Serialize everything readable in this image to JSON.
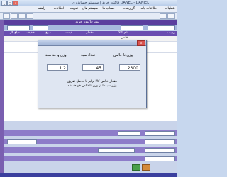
{
  "window": {
    "title": "فاکتور خرید  |  سیستم حسابداری DANEL  -  DANIEL",
    "buttons": [
      "_",
      "□",
      "x"
    ]
  },
  "menu": {
    "items": [
      "عملیات",
      "اطلاعات پایه",
      "گزارشات",
      "حساب ها",
      "سیستم های",
      "تعریف",
      "امکانات",
      "راهنما"
    ]
  },
  "header": {
    "section_title": "ثبت فاکتور خرید"
  },
  "grid": {
    "columns": [
      "ردیف",
      "نام کالا",
      "مقدار",
      "قیمت",
      "مبلغ",
      "تخفیف",
      "مبلغ کل"
    ],
    "first_row_text": "قلمی"
  },
  "dialog": {
    "close_label": "x",
    "labels": {
      "net_weight": "وزن نا خالص",
      "count": "تعداد سبد",
      "unit_weight": "وزن واحد سبد"
    },
    "values": {
      "net_weight": "2300",
      "count": "45",
      "unit_weight": "1.2"
    },
    "note": "مقدار خالص کالا برابر با حاصل تفریق وزن سبدها از وزن ناخالص خواهد شد"
  }
}
